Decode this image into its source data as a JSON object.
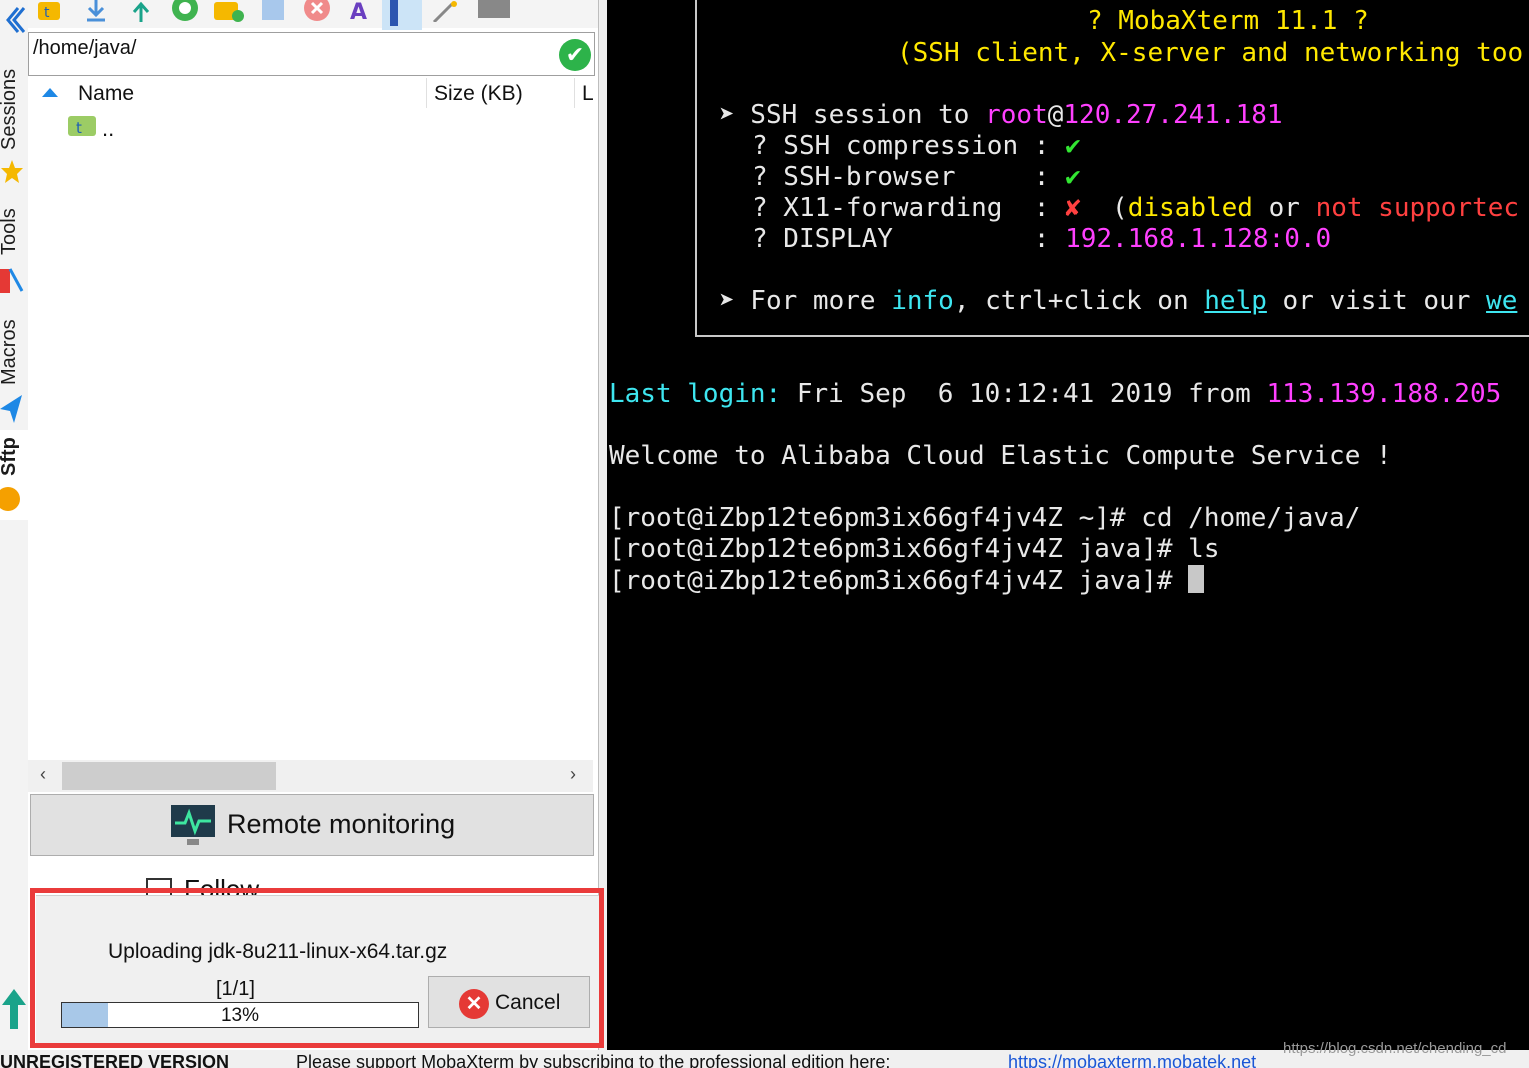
{
  "left_tabs": {
    "sessions": "Sessions",
    "tools": "Tools",
    "macros": "Macros",
    "sftp": "Sftp"
  },
  "sftp": {
    "path": "/home/java/",
    "columns": [
      "Name",
      "Size (KB)",
      "L"
    ],
    "parent_entry": "..",
    "remote_monitoring_label": "Remote monitoring",
    "follow_terminal_label": "Follow terminal folder",
    "follow_terminal_checked": false
  },
  "upload": {
    "file_text": "Uploading jdk-8u211-linux-x64.tar.gz",
    "count_text": "[1/1]",
    "progress_percent": 13,
    "progress_text": "13%",
    "cancel_label": "Cancel"
  },
  "terminal": {
    "banner_title": "? MobaXterm 11.1 ?",
    "banner_subtitle": "(SSH client, X-server and networking too",
    "session_prefix": "➤ SSH session to ",
    "session_user": "root",
    "session_host": "120.27.241.181",
    "compression_label": "? SSH compression : ",
    "compression_value": "✔",
    "browser_label": "? SSH-browser     : ",
    "browser_value": "✔",
    "x11_label": "? X11-forwarding  : ",
    "x11_value": "✘",
    "x11_paren_open": "  (",
    "x11_disabled": "disabled",
    "x11_or": " or ",
    "x11_notsupported": "not supportec",
    "display_label": "? DISPLAY         : ",
    "display_value": "192.168.1.128:0.0",
    "info_prefix": "➤ For more ",
    "info_word": "info",
    "info_mid": ", ctrl+click on ",
    "info_help": "help",
    "info_tail": " or visit our ",
    "info_web": "we",
    "last_login_label": "Last login:",
    "last_login_text": " Fri Sep  6 10:12:41 2019 from ",
    "last_login_ip": "113.139.188.205",
    "welcome": "Welcome to Alibaba Cloud Elastic Compute Service !",
    "lines": [
      "[root@iZbp12te6pm3ix66gf4jv4Z ~]# cd /home/java/",
      "[root@iZbp12te6pm3ix66gf4jv4Z java]# ls",
      "[root@iZbp12te6pm3ix66gf4jv4Z java]# "
    ]
  },
  "statusbar": {
    "left": "UNREGISTERED VERSION",
    "middle": "Please support MobaXterm by subscribing to the professional edition here:",
    "link": "https://mobaxterm.mobatek.net"
  },
  "watermark": "https://blog.csdn.net/chending_cd",
  "colors": {
    "accent": "#ea3b3b",
    "progress": "#a8c8e8",
    "terminal_bg": "#000000"
  }
}
